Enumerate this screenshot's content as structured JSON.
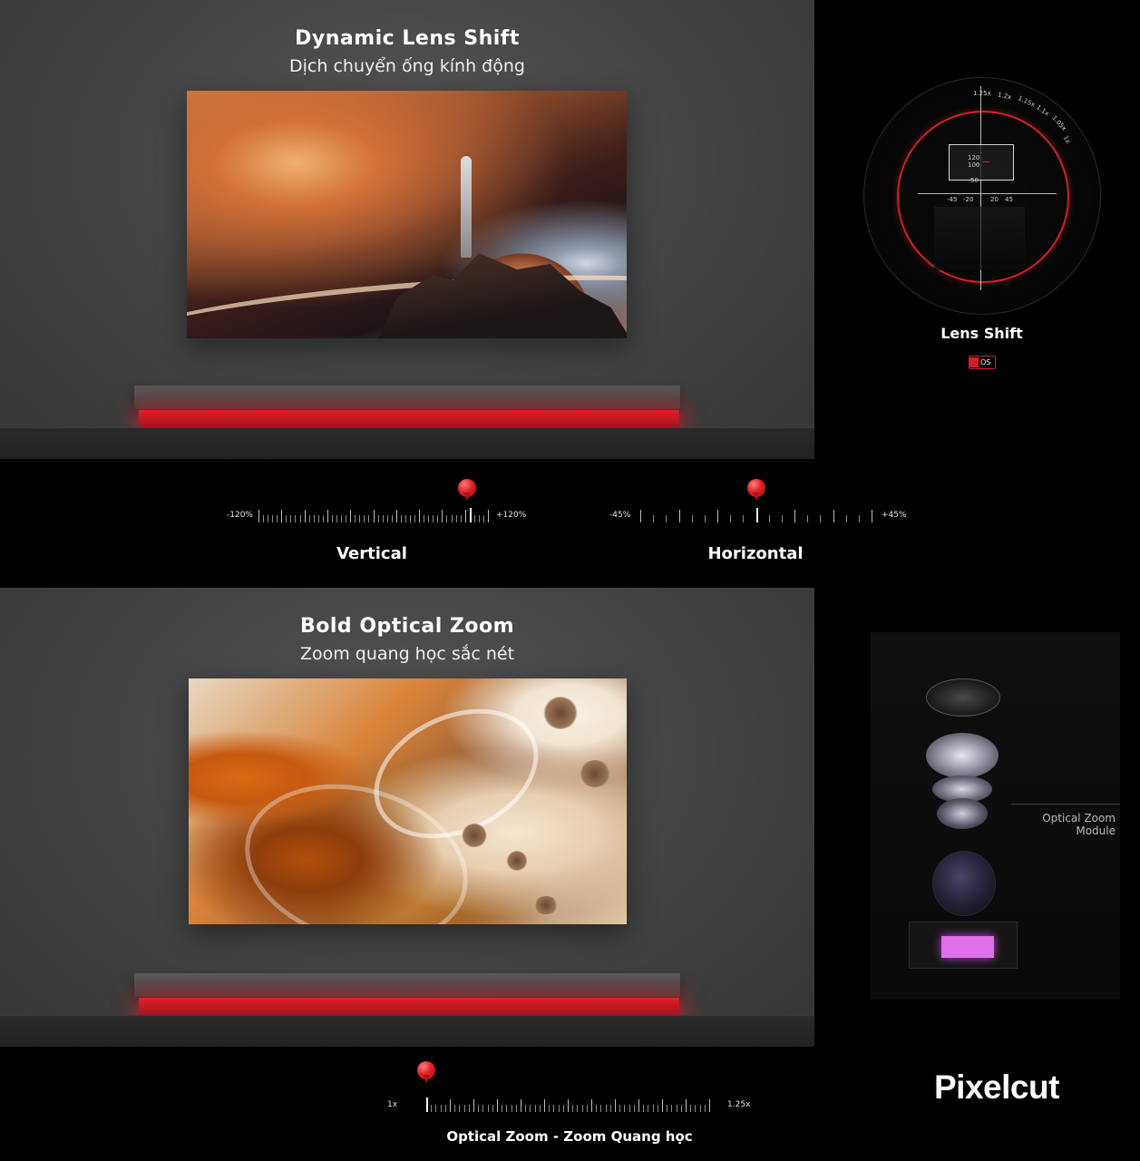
{
  "lens_shift": {
    "title": "Dynamic Lens Shift",
    "subtitle": "Dịch chuyển ống kính động",
    "dial": {
      "scale_labels": [
        "1.25x",
        "1.2x",
        "1.15x",
        "1.1x",
        "1.05x",
        "1x"
      ],
      "box_values": [
        "120",
        "100"
      ],
      "lower_value": "50",
      "axis_labels": [
        "-45",
        "-20",
        "20",
        "45"
      ]
    },
    "label": "Lens Shift",
    "badge": "OS",
    "vertical": {
      "label": "Vertical",
      "min_label": "-120%",
      "max_label": "+120%",
      "value_fraction": 0.91
    },
    "horizontal": {
      "label": "Horizontal",
      "min_label": "-45%",
      "max_label": "+45%",
      "value_fraction": 0.5
    }
  },
  "optical_zoom": {
    "title": "Bold Optical Zoom",
    "subtitle": "Zoom quang học sắc nét",
    "module_label": "Optical Zoom Module",
    "slider": {
      "label": "Optical Zoom - Zoom Quang học",
      "min_label": "1x",
      "max_label": "1.25x",
      "value_fraction": 0.0
    }
  },
  "brand": "Pixelcut",
  "colors": {
    "accent_red": "#e01f28",
    "background": "#000000",
    "room": "#464646"
  }
}
